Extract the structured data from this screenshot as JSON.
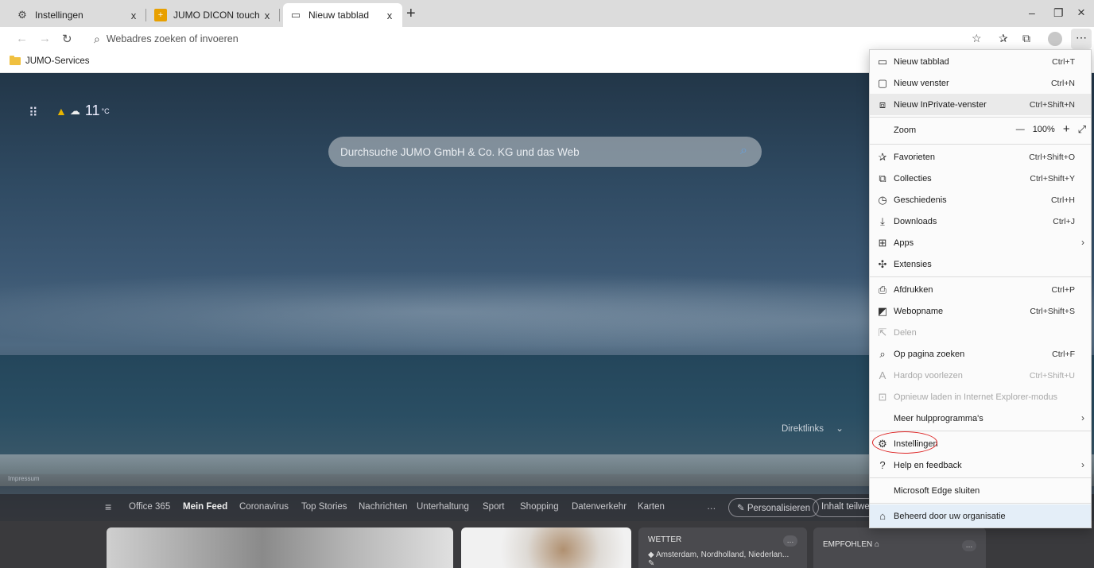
{
  "tabs": [
    {
      "label": "Instellingen",
      "icon": "gear-icon",
      "close": "x"
    },
    {
      "label": "JUMO DICON touch Online Visu",
      "icon": "jumo-app-icon",
      "close": "x"
    },
    {
      "label": "Nieuw tabblad",
      "icon": "new-tab-page-icon",
      "close": "x"
    }
  ],
  "new_tab_symbol": "+",
  "window_controls": {
    "minimize": "–",
    "restore": "❐",
    "close": "×"
  },
  "address": {
    "placeholder": "Webadres zoeken of invoeren"
  },
  "favorites_bar": {
    "folder_label": "JUMO-Services"
  },
  "newtab_page": {
    "temperature": "11",
    "temperature_unit": "°C",
    "search_placeholder": "Durchsuche JUMO GmbH & Co. KG und das Web",
    "direktlinks": "Direktlinks",
    "impressum": "Impressum",
    "feed_items": [
      "Office 365",
      "Mein Feed",
      "Coronavirus",
      "Top Stories",
      "Nachrichten",
      "Unterhaltung",
      "Sport",
      "Shopping",
      "Datenverkehr",
      "Karten"
    ],
    "feed_more": "…",
    "personalize": "Personalisieren",
    "content_partial": "Inhalt teilweis",
    "wetter_title": "WETTER",
    "wetter_location": "Amsterdam, Nordholland, Niederlan...",
    "empfohlen_title": "EMPFOHLEN",
    "card_more": "…"
  },
  "menu": {
    "items": [
      {
        "label": "Nieuw tabblad",
        "shortcut": "Ctrl+T",
        "icon": "new-tab-icon",
        "state": "normal"
      },
      {
        "label": "Nieuw venster",
        "shortcut": "Ctrl+N",
        "icon": "new-window-icon",
        "state": "normal"
      },
      {
        "label": "Nieuw InPrivate-venster",
        "shortcut": "Ctrl+Shift+N",
        "icon": "inprivate-window-icon",
        "state": "highlighted"
      },
      {
        "label": "Favorieten",
        "shortcut": "Ctrl+Shift+O",
        "icon": "favorites-icon",
        "state": "normal"
      },
      {
        "label": "Collecties",
        "shortcut": "Ctrl+Shift+Y",
        "icon": "collections-icon",
        "state": "normal"
      },
      {
        "label": "Geschiedenis",
        "shortcut": "Ctrl+H",
        "icon": "history-icon",
        "state": "normal"
      },
      {
        "label": "Downloads",
        "shortcut": "Ctrl+J",
        "icon": "download-icon",
        "state": "normal"
      },
      {
        "label": "Apps",
        "shortcut": "",
        "icon": "apps-icon",
        "state": "submenu"
      },
      {
        "label": "Extensies",
        "shortcut": "",
        "icon": "extensions-icon",
        "state": "normal"
      },
      {
        "label": "Afdrukken",
        "shortcut": "Ctrl+P",
        "icon": "print-icon",
        "state": "normal"
      },
      {
        "label": "Webopname",
        "shortcut": "Ctrl+Shift+S",
        "icon": "web-capture-icon",
        "state": "normal"
      },
      {
        "label": "Delen",
        "shortcut": "",
        "icon": "share-icon",
        "state": "disabled"
      },
      {
        "label": "Op pagina zoeken",
        "shortcut": "Ctrl+F",
        "icon": "find-on-page-icon",
        "state": "normal"
      },
      {
        "label": "Hardop voorlezen",
        "shortcut": "Ctrl+Shift+U",
        "icon": "read-aloud-icon",
        "state": "disabled"
      },
      {
        "label": "Opnieuw laden in Internet Explorer-modus",
        "shortcut": "",
        "icon": "ie-mode-icon",
        "state": "disabled"
      },
      {
        "label": "Meer hulpprogramma's",
        "shortcut": "",
        "icon": "",
        "state": "submenu"
      },
      {
        "label": "Instellingen",
        "shortcut": "",
        "icon": "gear-icon",
        "state": "annotated"
      },
      {
        "label": "Help en feedback",
        "shortcut": "",
        "icon": "help-icon",
        "state": "submenu"
      },
      {
        "label": "Microsoft Edge sluiten",
        "shortcut": "",
        "icon": "",
        "state": "normal"
      },
      {
        "label": "Beheerd door uw organisatie",
        "shortcut": "",
        "icon": "briefcase-icon",
        "state": "footer"
      }
    ],
    "zoom_label": "Zoom",
    "zoom_minus": "—",
    "zoom_value": "100%",
    "zoom_plus": "+",
    "zoom_fullscreen": "⤢"
  },
  "colors": {
    "annotation_circle": "#dd2222",
    "accent": "#0067c0"
  }
}
